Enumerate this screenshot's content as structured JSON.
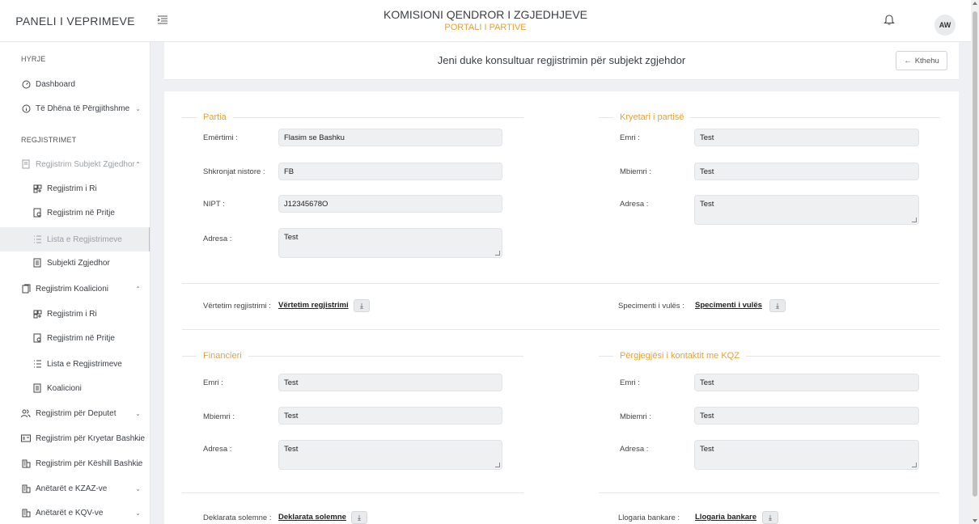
{
  "header": {
    "brand": "PANELI I VEPRIMEVE",
    "title": "KOMISIONI QENDROR I ZGJEDHJEVE",
    "subtitle": "PORTALI I PARTIVE",
    "avatar_initials": "AW"
  },
  "sidebar": {
    "section_hyrje": "HYRJE",
    "section_regjistrimet": "REGJISTRIMET",
    "items": [
      {
        "label": "Dashboard",
        "icon": "dashboard-icon"
      },
      {
        "label": "Të Dhëna të Përgjithshme",
        "icon": "info-icon"
      },
      {
        "label": "Regjistrim Subjekt Zgjedhor",
        "icon": "document-icon"
      },
      {
        "label": "Regjistrim i Ri",
        "icon": "new-entry-icon"
      },
      {
        "label": "Regjistrim në Pritje",
        "icon": "pending-icon"
      },
      {
        "label": "Lista e Regjistrimeve",
        "icon": "list-icon"
      },
      {
        "label": "Subjekti Zgjedhor",
        "icon": "subject-icon"
      },
      {
        "label": "Regjistrim Koalicioni",
        "icon": "coalition-icon"
      },
      {
        "label": "Regjistrim i Ri",
        "icon": "new-entry-icon"
      },
      {
        "label": "Regjistrim në Pritje",
        "icon": "pending-icon"
      },
      {
        "label": "Lista e Regjistrimeve",
        "icon": "list-icon"
      },
      {
        "label": "Koalicioni",
        "icon": "subject-icon"
      },
      {
        "label": "Regjistrim për Deputet",
        "icon": "users-icon"
      },
      {
        "label": "Regjistrim për Kryetar Bashkie",
        "icon": "id-card-icon"
      },
      {
        "label": "Regjistrim për Këshill Bashkie",
        "icon": "building-icon"
      },
      {
        "label": "Anëtarët e KZAZ-ve",
        "icon": "building-icon"
      },
      {
        "label": "Anëtarët e KQV-ve",
        "icon": "building-icon"
      }
    ]
  },
  "page": {
    "title": "Jeni duke konsultuar regjistrimin për subjekt zgjehdor",
    "back_label": "Kthehu"
  },
  "partia": {
    "legend": "Partia",
    "fields": [
      {
        "label": "Emërtimi :",
        "value": "Flasim se Bashku"
      },
      {
        "label": "Shkronjat nistore :",
        "value": "FB"
      },
      {
        "label": "NIPT :",
        "value": "J12345678O"
      },
      {
        "label": "Adresa :",
        "value": "Test"
      }
    ]
  },
  "kryetari": {
    "legend": "Kryetari i partisë",
    "fields": [
      {
        "label": "Emri :",
        "value": "Test"
      },
      {
        "label": "Mbiemri :",
        "value": "Test"
      },
      {
        "label": "Adresa :",
        "value": "Test"
      }
    ]
  },
  "docs1": {
    "left_label": "Vërtetim regjistrimi :",
    "left_link": "Vërtetim regjistrimi",
    "right_label": "Specimenti i vulës :",
    "right_link": "Specimenti i vulës"
  },
  "financieri": {
    "legend": "Financieri",
    "fields": [
      {
        "label": "Emri :",
        "value": "Test"
      },
      {
        "label": "Mbiemri :",
        "value": "Test"
      },
      {
        "label": "Adresa :",
        "value": "Test"
      }
    ]
  },
  "pergjegjesi": {
    "legend": "Përgjegjësi i kontaktit me KQZ",
    "fields": [
      {
        "label": "Emri :",
        "value": "Test"
      },
      {
        "label": "Mbiemri :",
        "value": "Test"
      },
      {
        "label": "Adresa :",
        "value": "Test"
      }
    ]
  },
  "docs2": {
    "left_label": "Deklarata solemne :",
    "left_link": "Deklarata solemne",
    "right_label": "Llogaria bankare :",
    "right_link": "Llogaria bankare"
  },
  "colors": {
    "accent": "#e8a033",
    "frame": "#e8a04a"
  }
}
